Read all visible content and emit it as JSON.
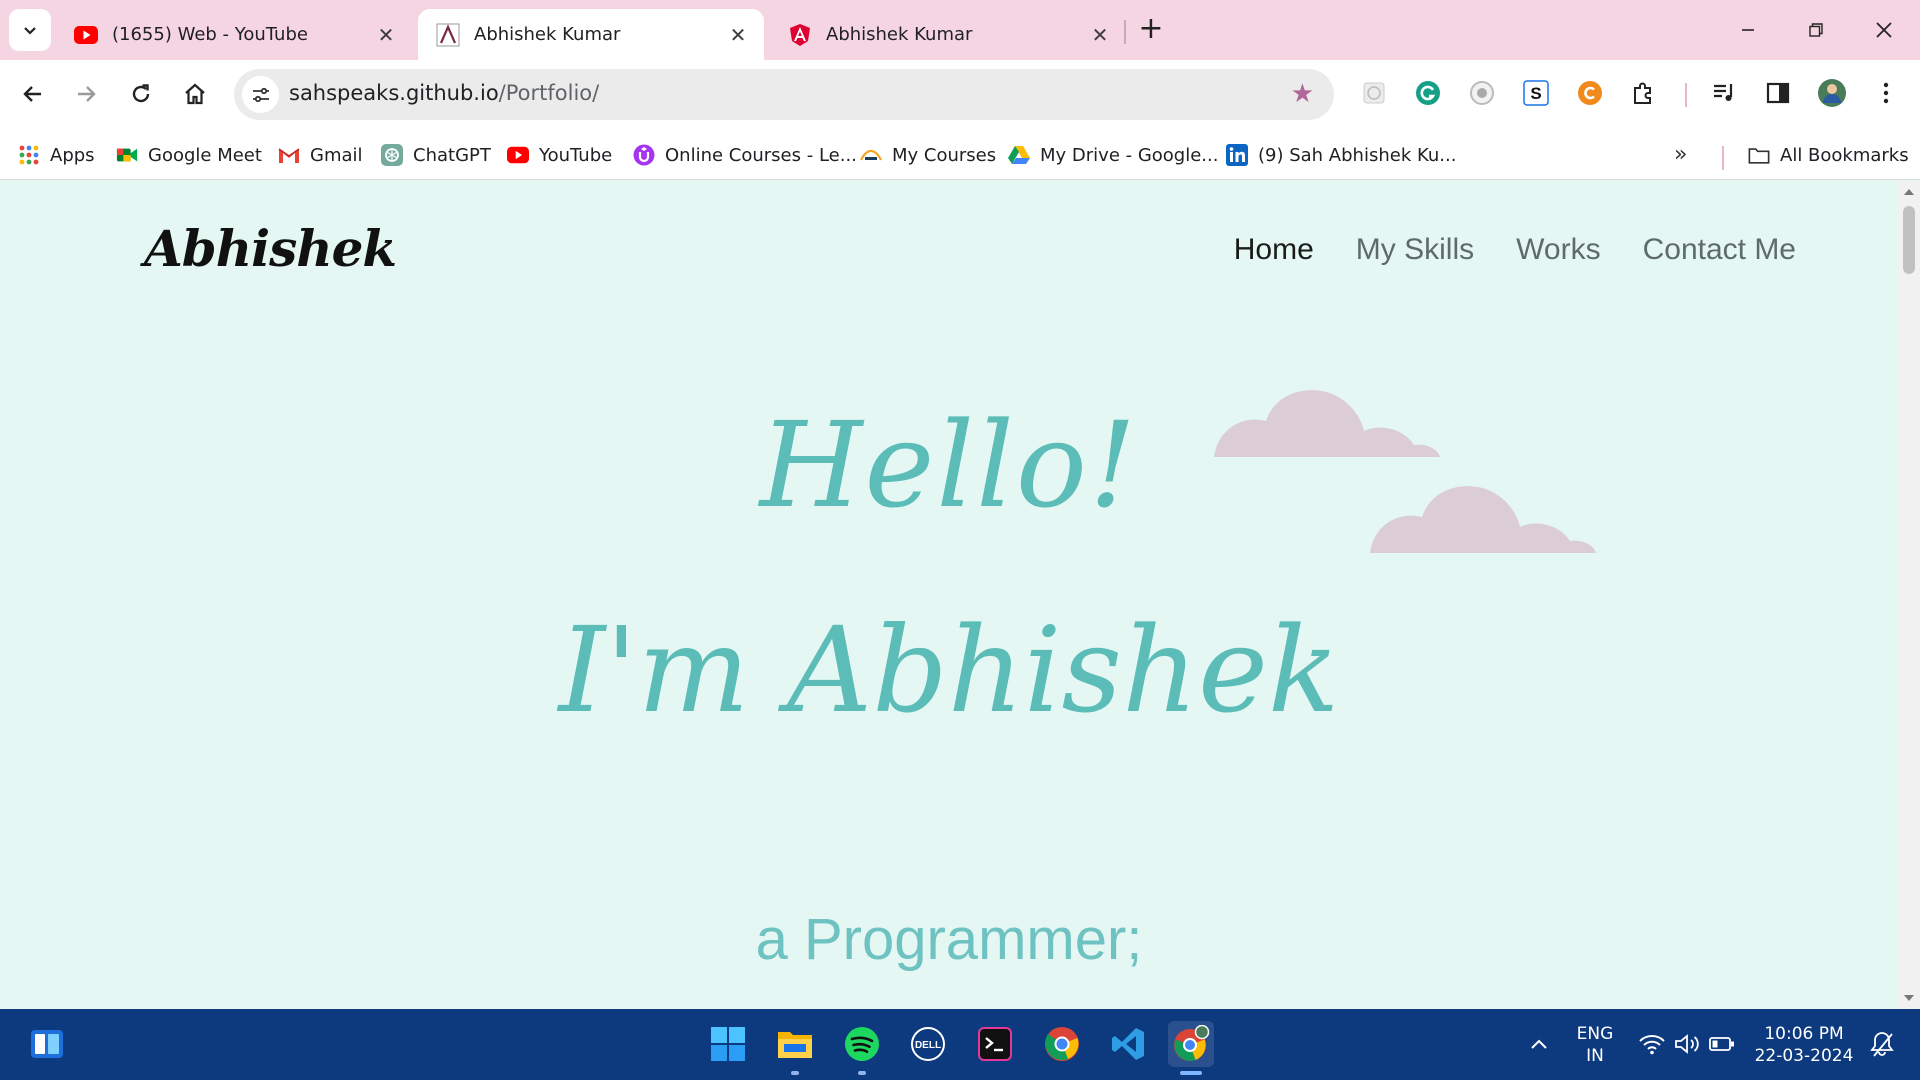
{
  "tabs": [
    {
      "title": "(1655) Web - YouTube",
      "icon": "youtube-icon",
      "active": false
    },
    {
      "title": "Abhishek Kumar",
      "icon": "portfolio-favicon-icon",
      "active": true
    },
    {
      "title": "Abhishek Kumar",
      "icon": "angular-icon",
      "active": false
    }
  ],
  "toolbar": {
    "url_host": "sahspeaks.github.io",
    "url_path": "/Portfolio/"
  },
  "bookmarks": [
    {
      "label": "Apps",
      "icon": "apps-grid-icon"
    },
    {
      "label": "Google Meet",
      "icon": "google-meet-icon"
    },
    {
      "label": "Gmail",
      "icon": "gmail-icon"
    },
    {
      "label": "ChatGPT",
      "icon": "chatgpt-icon"
    },
    {
      "label": "YouTube",
      "icon": "youtube-icon"
    },
    {
      "label": "Online Courses - Le...",
      "icon": "udemy-icon"
    },
    {
      "label": "My Courses",
      "icon": "courses-icon"
    },
    {
      "label": "My Drive - Google...",
      "icon": "google-drive-icon"
    },
    {
      "label": "(9) Sah Abhishek Ku...",
      "icon": "linkedin-icon"
    }
  ],
  "bookmarks_all": "All Bookmarks",
  "site": {
    "logo": "Abhishek",
    "nav": [
      "Home",
      "My Skills",
      "Works",
      "Contact Me"
    ],
    "hello": "Hello!",
    "intro": "I'm Abhishek",
    "role": "a Programmer;"
  },
  "tray": {
    "lang": "ENG",
    "region": "IN",
    "time": "10:06 PM",
    "date": "22-03-2024"
  },
  "colors": {
    "tab_strip": "#f6d5e3",
    "page_bg": "#e4f7f3",
    "accent_teal": "#5bbcb8",
    "cloud": "#dccdd4",
    "taskbar": "#0d3a7f"
  }
}
